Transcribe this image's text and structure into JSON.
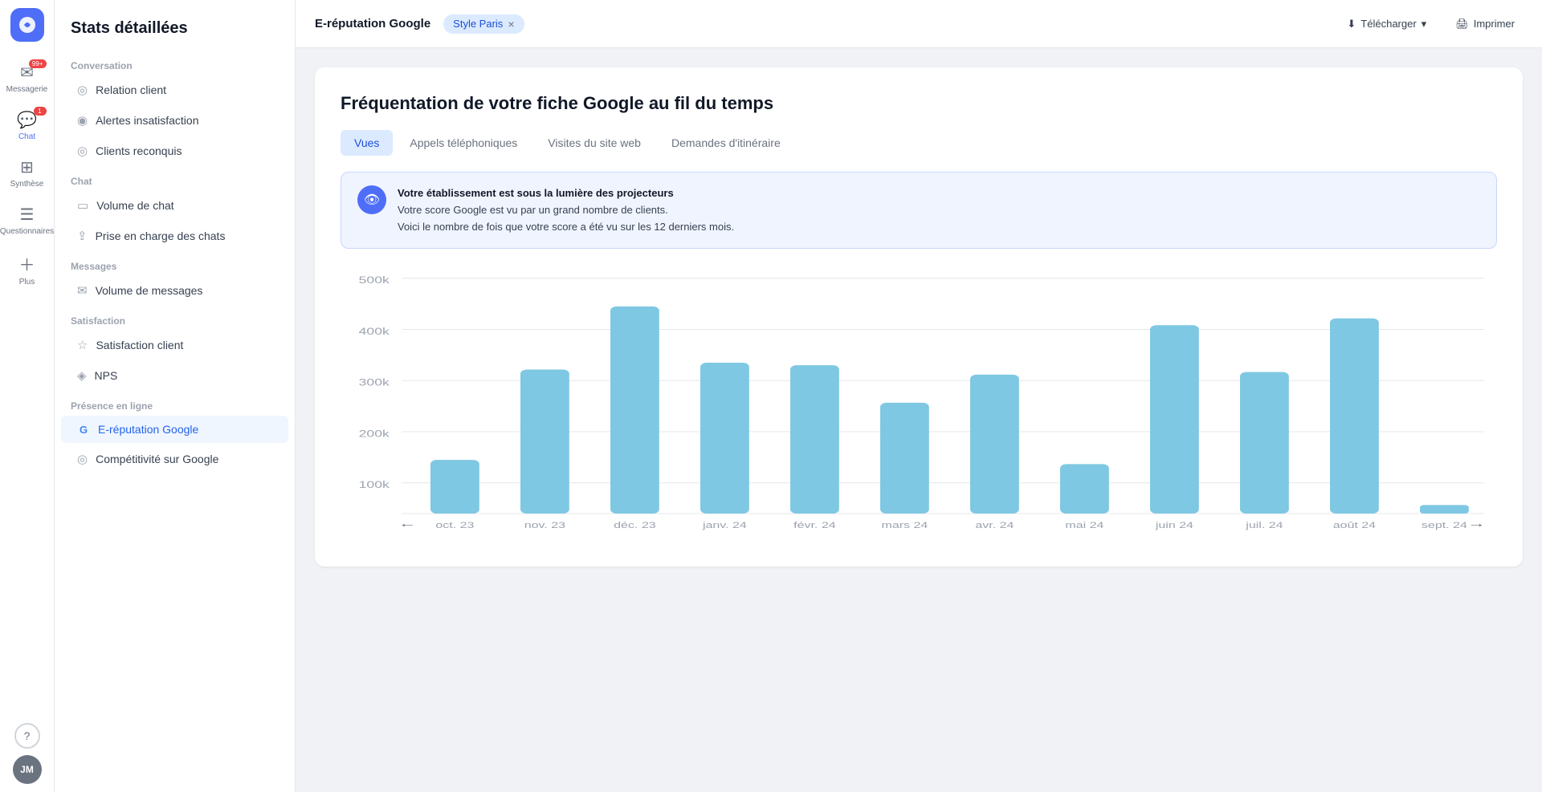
{
  "app": {
    "logo_label": "App",
    "page_title": "Stats détaillées"
  },
  "icon_bar": {
    "items": [
      {
        "id": "messagerie",
        "label": "Messagerie",
        "icon": "✉",
        "badge": "99+",
        "active": false
      },
      {
        "id": "chat",
        "label": "Chat",
        "icon": "💬",
        "badge": "1",
        "active": true
      },
      {
        "id": "synthese",
        "label": "Synthèse",
        "icon": "⊞",
        "badge": null,
        "active": false
      },
      {
        "id": "questionnaires",
        "label": "Questionnaires",
        "icon": "☰",
        "badge": null,
        "active": false
      },
      {
        "id": "plus",
        "label": "Plus",
        "icon": "+",
        "badge": null,
        "active": false
      }
    ],
    "help_label": "?",
    "avatar_initials": "JM"
  },
  "sidebar": {
    "title": "Stats détaillées",
    "sections": [
      {
        "label": "Conversation",
        "items": [
          {
            "id": "relation-client",
            "label": "Relation client",
            "icon": "◎",
            "active": false
          },
          {
            "id": "alertes-insatisfaction",
            "label": "Alertes insatisfaction",
            "icon": "◉",
            "active": false
          },
          {
            "id": "clients-reconquis",
            "label": "Clients reconquis",
            "icon": "◎",
            "active": false
          }
        ]
      },
      {
        "label": "Chat",
        "items": [
          {
            "id": "volume-chat",
            "label": "Volume de chat",
            "icon": "▭",
            "active": false
          },
          {
            "id": "prise-en-charge",
            "label": "Prise en charge des chats",
            "icon": "⇪",
            "active": false
          }
        ]
      },
      {
        "label": "Messages",
        "items": [
          {
            "id": "volume-messages",
            "label": "Volume de messages",
            "icon": "✉",
            "active": false
          }
        ]
      },
      {
        "label": "Satisfaction",
        "items": [
          {
            "id": "satisfaction-client",
            "label": "Satisfaction client",
            "icon": "☆",
            "active": false
          },
          {
            "id": "nps",
            "label": "NPS",
            "icon": "◈",
            "active": false
          }
        ]
      },
      {
        "label": "Présence en ligne",
        "items": [
          {
            "id": "e-reputation-google",
            "label": "E-réputation Google",
            "icon": "G",
            "active": true
          },
          {
            "id": "competitivite-google",
            "label": "Compétitivité sur Google",
            "icon": "◎",
            "active": false
          }
        ]
      }
    ]
  },
  "topbar": {
    "title": "E-réputation Google",
    "chip_label": "Style Paris",
    "chip_close": "×",
    "download_label": "Télécharger",
    "print_label": "Imprimer"
  },
  "main": {
    "chart_title": "Fréquentation de votre fiche Google au fil du temps",
    "tabs": [
      {
        "id": "vues",
        "label": "Vues",
        "active": true
      },
      {
        "id": "appels",
        "label": "Appels téléphoniques",
        "active": false
      },
      {
        "id": "visites",
        "label": "Visites du site web",
        "active": false
      },
      {
        "id": "itineraire",
        "label": "Demandes d'itinéraire",
        "active": false
      }
    ],
    "banner": {
      "title": "Votre établissement est sous la lumière des projecteurs",
      "line1": "Votre score Google est vu par un grand nombre de clients.",
      "line2": "Voici le nombre de fois que votre score a été vu sur les 12 derniers mois."
    },
    "chart": {
      "y_labels": [
        "500k",
        "400k",
        "300k",
        "200k",
        "100k",
        ""
      ],
      "bars": [
        {
          "month": "oct. 23",
          "value": 115000,
          "max": 500000
        },
        {
          "month": "nov. 23",
          "value": 305000,
          "max": 500000
        },
        {
          "month": "déc. 23",
          "value": 440000,
          "max": 500000
        },
        {
          "month": "janv. 24",
          "value": 320000,
          "max": 500000
        },
        {
          "month": "févr. 24",
          "value": 315000,
          "max": 500000
        },
        {
          "month": "mars 24",
          "value": 235000,
          "max": 500000
        },
        {
          "month": "avr. 24",
          "value": 295000,
          "max": 500000
        },
        {
          "month": "mai 24",
          "value": 105000,
          "max": 500000
        },
        {
          "month": "juin 24",
          "value": 400000,
          "max": 500000
        },
        {
          "month": "juil. 24",
          "value": 300000,
          "max": 500000
        },
        {
          "month": "août 24",
          "value": 415000,
          "max": 500000
        },
        {
          "month": "sept. 24",
          "value": 18000,
          "max": 500000
        }
      ],
      "nav_prev": "←",
      "nav_next": "→"
    }
  }
}
